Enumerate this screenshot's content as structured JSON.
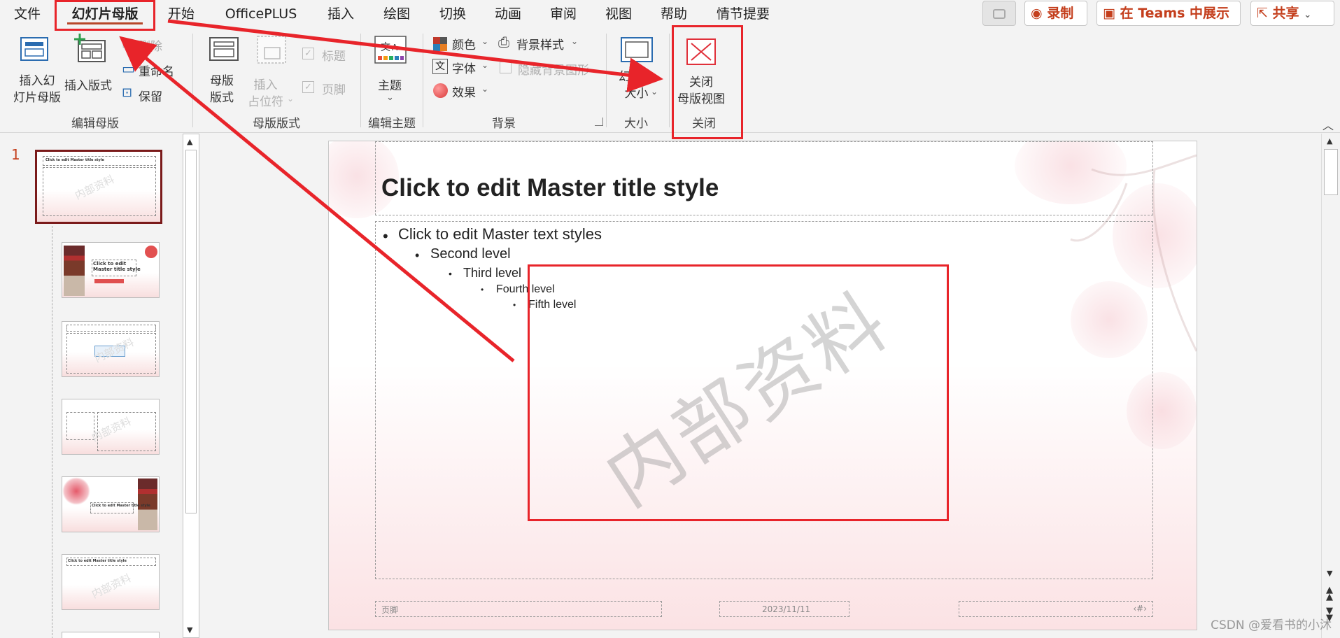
{
  "menu": {
    "tabs": [
      "文件",
      "幻灯片母版",
      "开始",
      "OfficePLUS",
      "插入",
      "绘图",
      "切换",
      "动画",
      "审阅",
      "视图",
      "帮助",
      "情节提要"
    ],
    "record_label": "录制",
    "teams_label": "在 Teams 中展示",
    "share_label": "共享"
  },
  "ribbon": {
    "edit_master": {
      "insert_master": "插入幻\n灯片母版",
      "insert_layout": "插入版式",
      "delete": "删除",
      "rename": "重命名",
      "preserve": "保留",
      "group": "编辑母版"
    },
    "master_layout": {
      "master_layout": "母版\n版式",
      "insert_placeholder": "插入\n占位符",
      "title_check": "标题",
      "footer_check": "页脚",
      "group": "母版版式"
    },
    "edit_theme": {
      "themes": "主题",
      "group": "编辑主题"
    },
    "background": {
      "colors": "颜色",
      "fonts": "字体",
      "effects": "效果",
      "bg_styles": "背景样式",
      "hide_bg": "隐藏背景图形",
      "group": "背景"
    },
    "size": {
      "slide_size": "幻灯片\n大小",
      "group": "大小"
    },
    "close": {
      "close_master": "关闭\n母版视图",
      "group": "关闭"
    }
  },
  "thumbnails": {
    "slide_number": "1",
    "thumb_title": "Click to edit Master title style",
    "thumb_title_2": "Click to edit\nMaster title style",
    "watermark": "内部资料"
  },
  "slide": {
    "title": "Click to edit Master title style",
    "levels": [
      "Click to edit Master text styles",
      "Second level",
      "Third level",
      "Fourth level",
      "Fifth level"
    ],
    "watermark": "内部资料",
    "footer": "页脚",
    "date": "2023/11/11",
    "page_num": "‹#›"
  },
  "credit": "CSDN @爱看书的小沐",
  "colors": {
    "accent": "#b7472a",
    "annotation": "#e8242a",
    "pink": "#fbe2e4"
  }
}
